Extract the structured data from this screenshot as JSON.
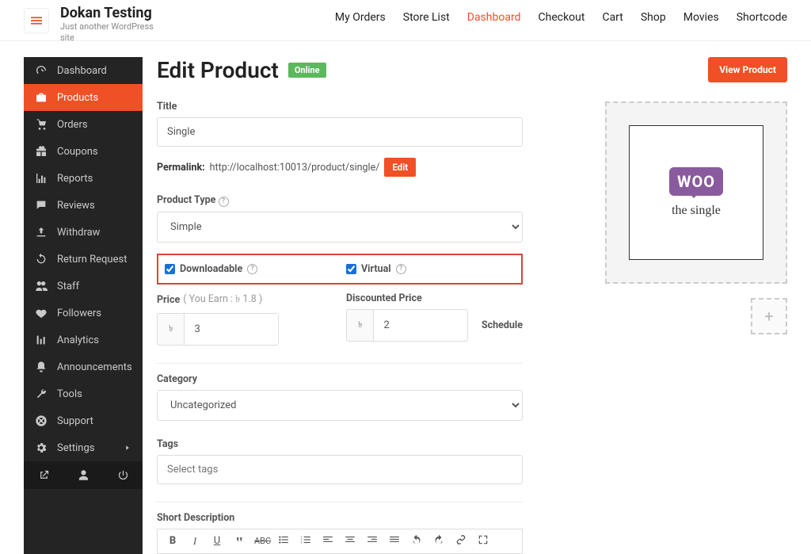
{
  "brand": {
    "title": "Dokan Testing",
    "tagline": "Just another WordPress site"
  },
  "topnav": {
    "items": [
      "My Orders",
      "Store List",
      "Dashboard",
      "Checkout",
      "Cart",
      "Shop",
      "Movies",
      "Shortcode"
    ],
    "active": 2
  },
  "sidebar": {
    "items": [
      {
        "label": "Dashboard",
        "icon": "tachometer"
      },
      {
        "label": "Products",
        "icon": "briefcase",
        "active": true
      },
      {
        "label": "Orders",
        "icon": "cart"
      },
      {
        "label": "Coupons",
        "icon": "gift"
      },
      {
        "label": "Reports",
        "icon": "chart"
      },
      {
        "label": "Reviews",
        "icon": "comments"
      },
      {
        "label": "Withdraw",
        "icon": "upload"
      },
      {
        "label": "Return Request",
        "icon": "refresh"
      },
      {
        "label": "Staff",
        "icon": "users"
      },
      {
        "label": "Followers",
        "icon": "heart"
      },
      {
        "label": "Analytics",
        "icon": "chart2"
      },
      {
        "label": "Announcements",
        "icon": "bell"
      },
      {
        "label": "Tools",
        "icon": "wrench"
      },
      {
        "label": "Support",
        "icon": "life-ring"
      },
      {
        "label": "Settings",
        "icon": "cog",
        "chevron": true
      }
    ]
  },
  "page": {
    "heading": "Edit Product",
    "status": "Online",
    "view_btn": "View Product",
    "title_label": "Title",
    "title_value": "Single",
    "permalink_label": "Permalink:",
    "permalink_url": "http://localhost:10013/product/single/",
    "edit": "Edit",
    "product_type_label": "Product Type",
    "product_type_value": "Simple",
    "downloadable": "Downloadable",
    "virtual": "Virtual",
    "price_label": "Price",
    "earn": "( You Earn :  ৳  1.8 )",
    "currency": "৳",
    "price_value": "3",
    "discount_label": "Discounted Price",
    "discount_value": "2",
    "schedule": "Schedule",
    "category_label": "Category",
    "category_value": "Uncategorized",
    "tags_label": "Tags",
    "tags_placeholder": "Select tags",
    "shortdesc_label": "Short Description",
    "woo_text": "WOO",
    "woo_script": "the  single"
  }
}
